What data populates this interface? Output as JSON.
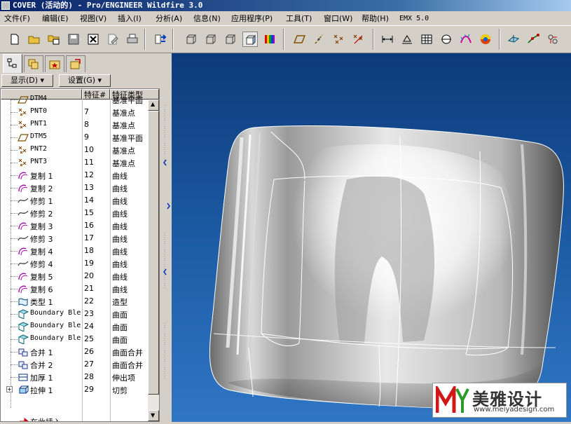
{
  "window": {
    "title": "COVER (活动的) - Pro/ENGINEER Wildfire 3.0"
  },
  "menu": [
    {
      "label": "文件(F)"
    },
    {
      "label": "编辑(E)"
    },
    {
      "label": "视图(V)"
    },
    {
      "label": "插入(I)"
    },
    {
      "label": "分析(A)"
    },
    {
      "label": "信息(N)"
    },
    {
      "label": "应用程序(P)"
    },
    {
      "label": "工具(T)"
    },
    {
      "label": "窗口(W)"
    },
    {
      "label": "帮助(H)"
    },
    {
      "label": "EMX 5.0"
    }
  ],
  "panel": {
    "show_label": "显示(D)",
    "settings_label": "设置(G)",
    "columns": {
      "id": "特征#",
      "type": "特征类型"
    },
    "rows": [
      {
        "name": "DTM4",
        "id": "",
        "type": "基准平面",
        "icon": "datum-plane"
      },
      {
        "name": "PNT0",
        "id": "7",
        "type": "基准点",
        "icon": "datum-point"
      },
      {
        "name": "PNT1",
        "id": "8",
        "type": "基准点",
        "icon": "datum-point"
      },
      {
        "name": "DTM5",
        "id": "9",
        "type": "基准平面",
        "icon": "datum-plane"
      },
      {
        "name": "PNT2",
        "id": "10",
        "type": "基准点",
        "icon": "datum-point"
      },
      {
        "name": "PNT3",
        "id": "11",
        "type": "基准点",
        "icon": "datum-point"
      },
      {
        "name": "复制 1",
        "id": "12",
        "type": "曲线",
        "icon": "copy-curve"
      },
      {
        "name": "复制 2",
        "id": "13",
        "type": "曲线",
        "icon": "copy-curve"
      },
      {
        "name": "修剪 1",
        "id": "14",
        "type": "曲线",
        "icon": "trim-curve"
      },
      {
        "name": "修剪 2",
        "id": "15",
        "type": "曲线",
        "icon": "trim-curve"
      },
      {
        "name": "复制 3",
        "id": "16",
        "type": "曲线",
        "icon": "copy-curve"
      },
      {
        "name": "修剪 3",
        "id": "17",
        "type": "曲线",
        "icon": "trim-curve"
      },
      {
        "name": "复制 4",
        "id": "18",
        "type": "曲线",
        "icon": "copy-curve"
      },
      {
        "name": "修剪 4",
        "id": "19",
        "type": "曲线",
        "icon": "trim-curve"
      },
      {
        "name": "复制 5",
        "id": "20",
        "type": "曲线",
        "icon": "copy-curve"
      },
      {
        "name": "复制 6",
        "id": "21",
        "type": "曲线",
        "icon": "copy-curve"
      },
      {
        "name": "类型 1",
        "id": "22",
        "type": "造型",
        "icon": "style"
      },
      {
        "name": "Boundary Ble",
        "id": "23",
        "type": "曲面",
        "icon": "boundary-blend"
      },
      {
        "name": "Boundary Ble",
        "id": "24",
        "type": "曲面",
        "icon": "boundary-blend"
      },
      {
        "name": "Boundary Ble",
        "id": "25",
        "type": "曲面",
        "icon": "boundary-blend"
      },
      {
        "name": "合并 1",
        "id": "26",
        "type": "曲面合并",
        "icon": "merge"
      },
      {
        "name": "合并 2",
        "id": "27",
        "type": "曲面合并",
        "icon": "merge"
      },
      {
        "name": "加厚 1",
        "id": "28",
        "type": "伸出项",
        "icon": "thicken"
      },
      {
        "name": "拉伸 1",
        "id": "29",
        "type": "切剪",
        "icon": "extrude"
      }
    ],
    "insert_here": "在此插入"
  },
  "watermark": {
    "name": "美雅设计",
    "url": "www.meiyadesign.com"
  },
  "colors": {
    "title_start": "#0a246a",
    "viewport_top": "#0d3a7a",
    "viewport_bottom": "#2f76c4",
    "insert_arrow": "#cc0000"
  }
}
